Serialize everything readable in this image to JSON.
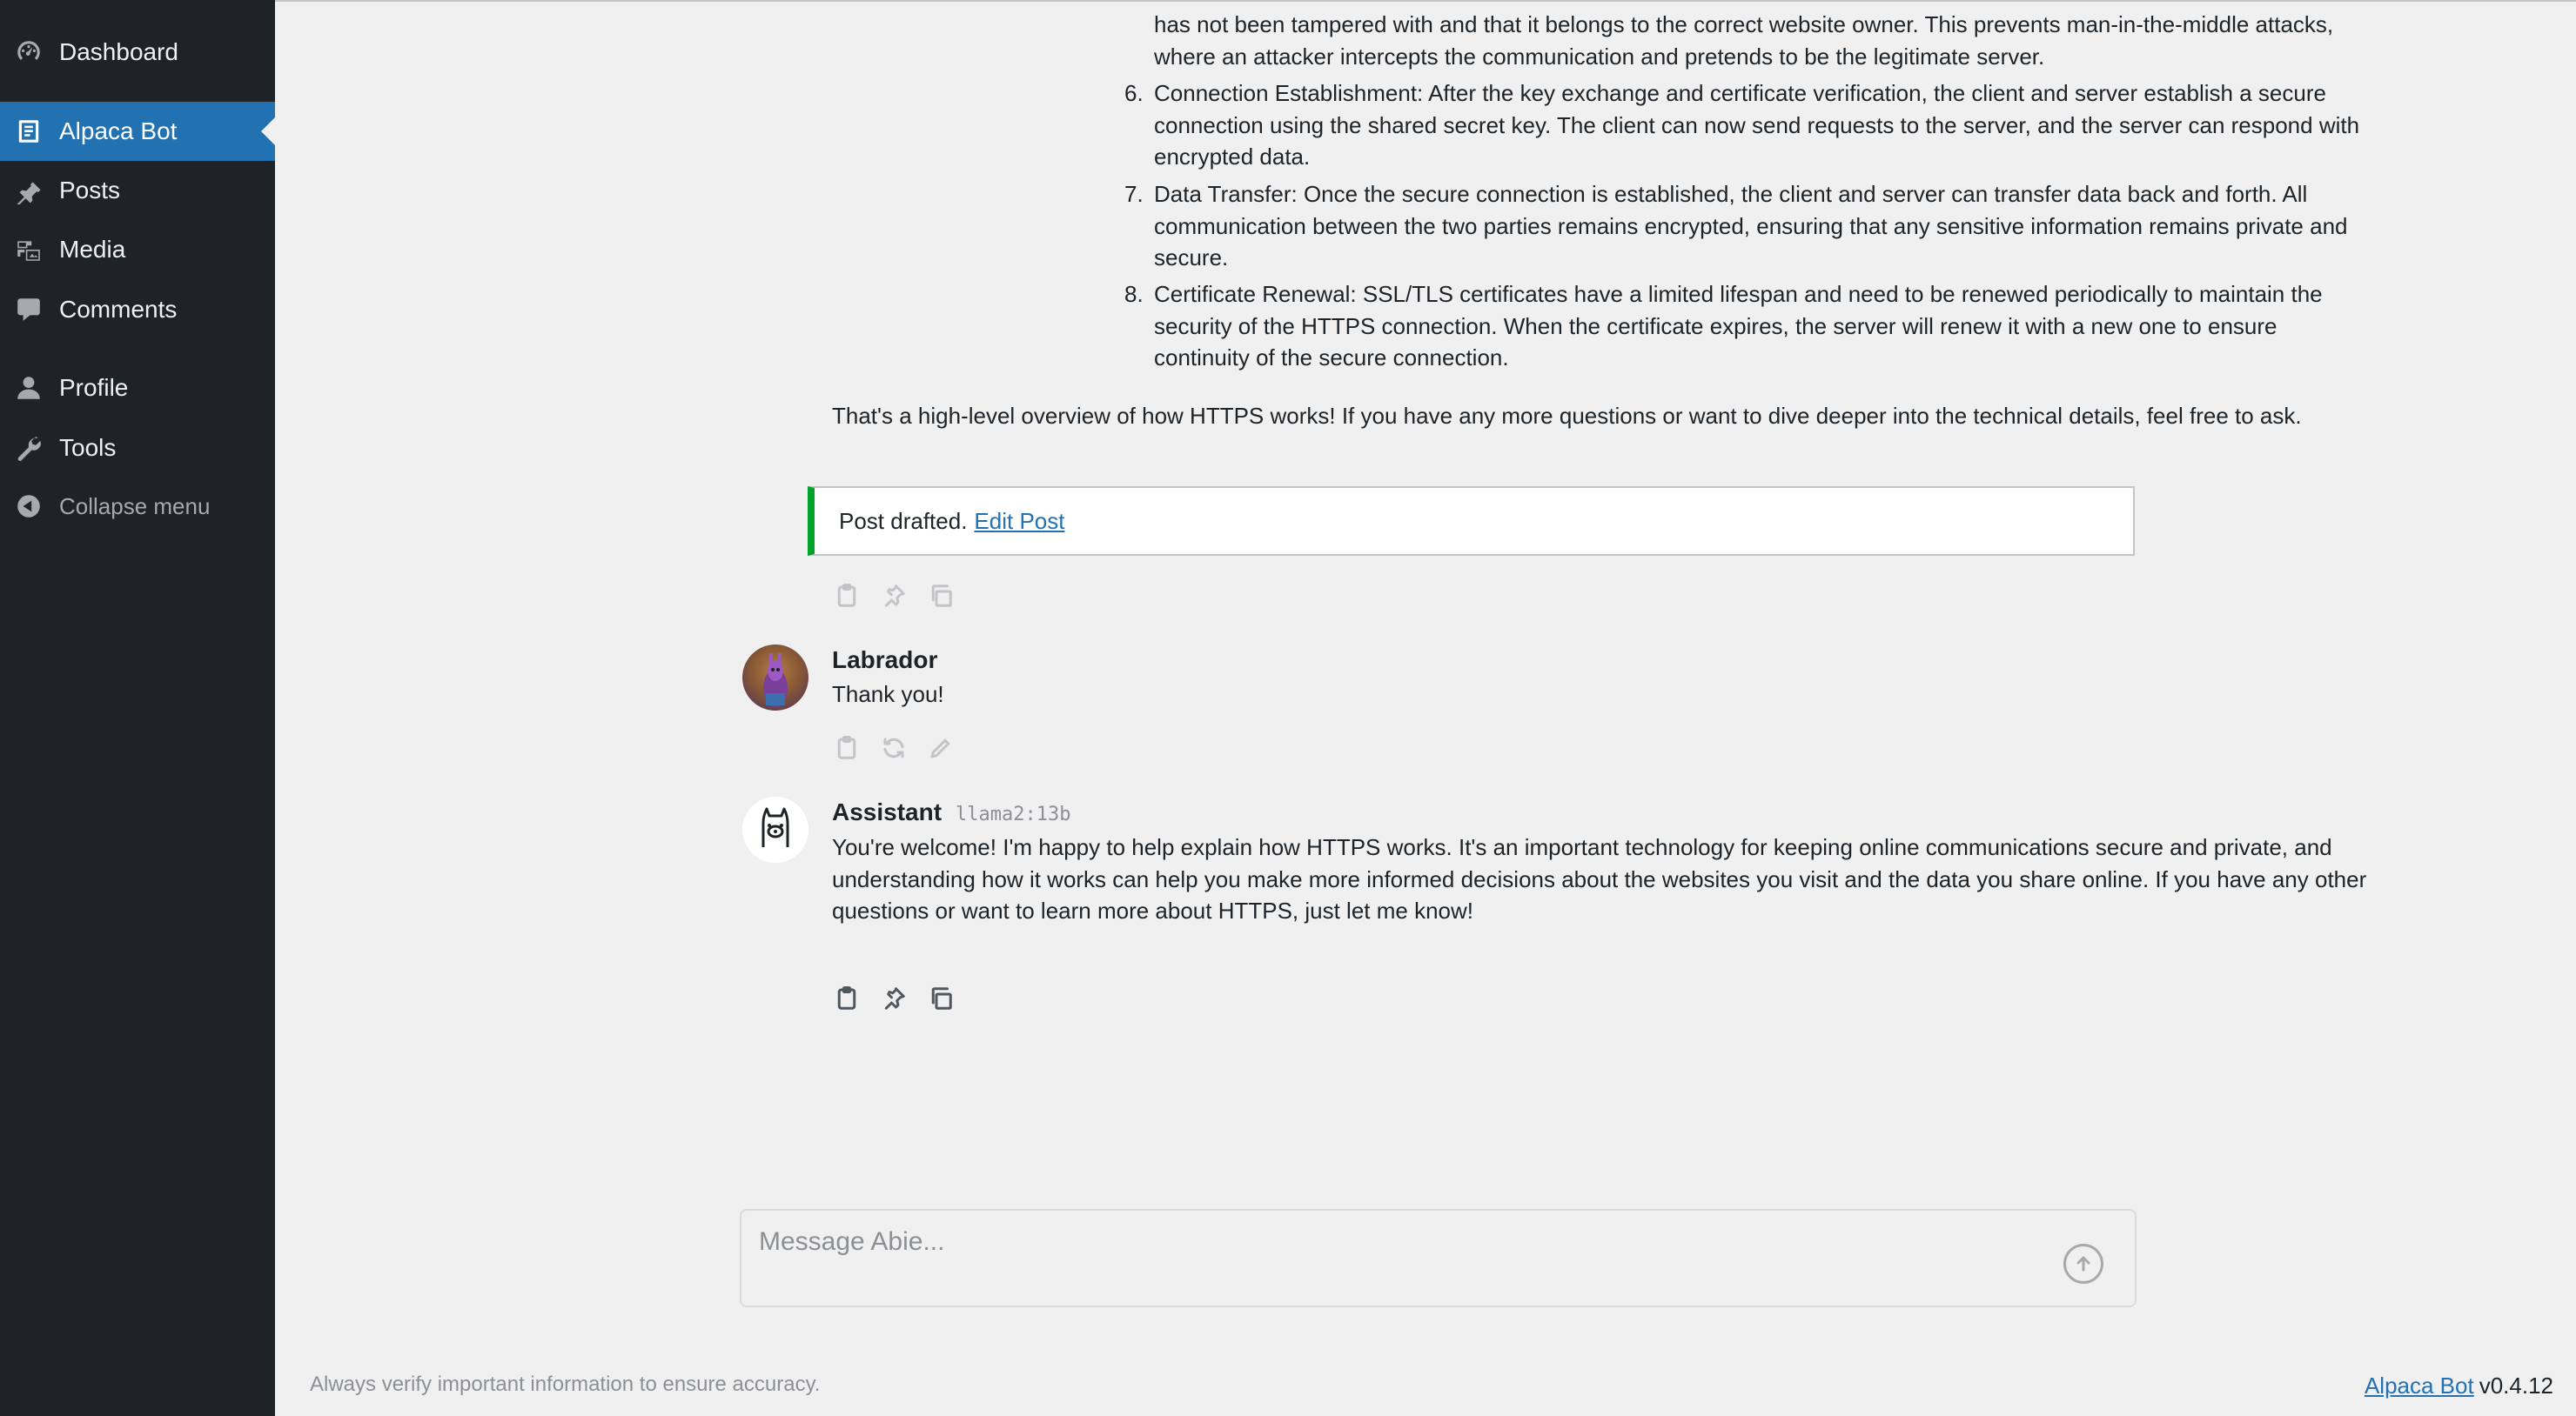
{
  "sidebar": {
    "items": [
      {
        "label": "Dashboard",
        "icon": "dashboard-icon"
      },
      {
        "label": "Alpaca Bot",
        "icon": "document-icon",
        "active": true
      },
      {
        "label": "Posts",
        "icon": "pin-icon"
      },
      {
        "label": "Media",
        "icon": "media-icon"
      },
      {
        "label": "Comments",
        "icon": "comment-icon"
      },
      {
        "label": "Profile",
        "icon": "user-icon"
      },
      {
        "label": "Tools",
        "icon": "wrench-icon"
      }
    ],
    "collapse_label": "Collapse menu"
  },
  "conversation": {
    "partial_item": {
      "lines": [
        "has not been tampered with and that it belongs to the correct website owner. This prevents man-in-the-middle attacks,",
        "where an attacker intercepts the communication and pretends to be the legitimate server."
      ]
    },
    "list_items": [
      {
        "number": "6.",
        "text": "Connection Establishment: After the key exchange and certificate verification, the client and server establish a secure connection using the shared secret key. The client can now send requests to the server, and the server can respond with encrypted data."
      },
      {
        "number": "7.",
        "text": "Data Transfer: Once the secure connection is established, the client and server can transfer data back and forth. All communication between the two parties remains encrypted, ensuring that any sensitive information remains private and secure."
      },
      {
        "number": "8.",
        "text": "Certificate Renewal: SSL/TLS certificates have a limited lifespan and need to be renewed periodically to maintain the security of the HTTPS connection. When the certificate expires, the server will renew it with a new one to ensure continuity of the secure connection."
      }
    ],
    "summary": "That's a high-level overview of how HTTPS works! If you have any more questions or want to dive deeper into the technical details, feel free to ask.",
    "notice": {
      "text": "Post drafted.",
      "link_label": "Edit Post",
      "accent": "#00a32a"
    },
    "user_message": {
      "name": "Labrador",
      "text": "Thank you!"
    },
    "assistant_message": {
      "name": "Assistant",
      "model": "llama2:13b",
      "text": "You're welcome! I'm happy to help explain how HTTPS works. It's an important technology for keeping online communications secure and private, and understanding how it works can help you make more informed decisions about the websites you visit and the data you share online. If you have any other questions or want to learn more about HTTPS, just let me know!"
    }
  },
  "composer": {
    "placeholder": "Message Abie...",
    "value": ""
  },
  "footer": {
    "disclaimer": "Always verify important information to ensure accuracy.",
    "plugin_link": "Alpaca Bot",
    "version": "v0.4.12"
  },
  "colors": {
    "sidebar_bg": "#1d2327",
    "active_bg": "#2271b1",
    "page_bg": "#f0f0f1",
    "link": "#2271b1",
    "success": "#00a32a"
  }
}
